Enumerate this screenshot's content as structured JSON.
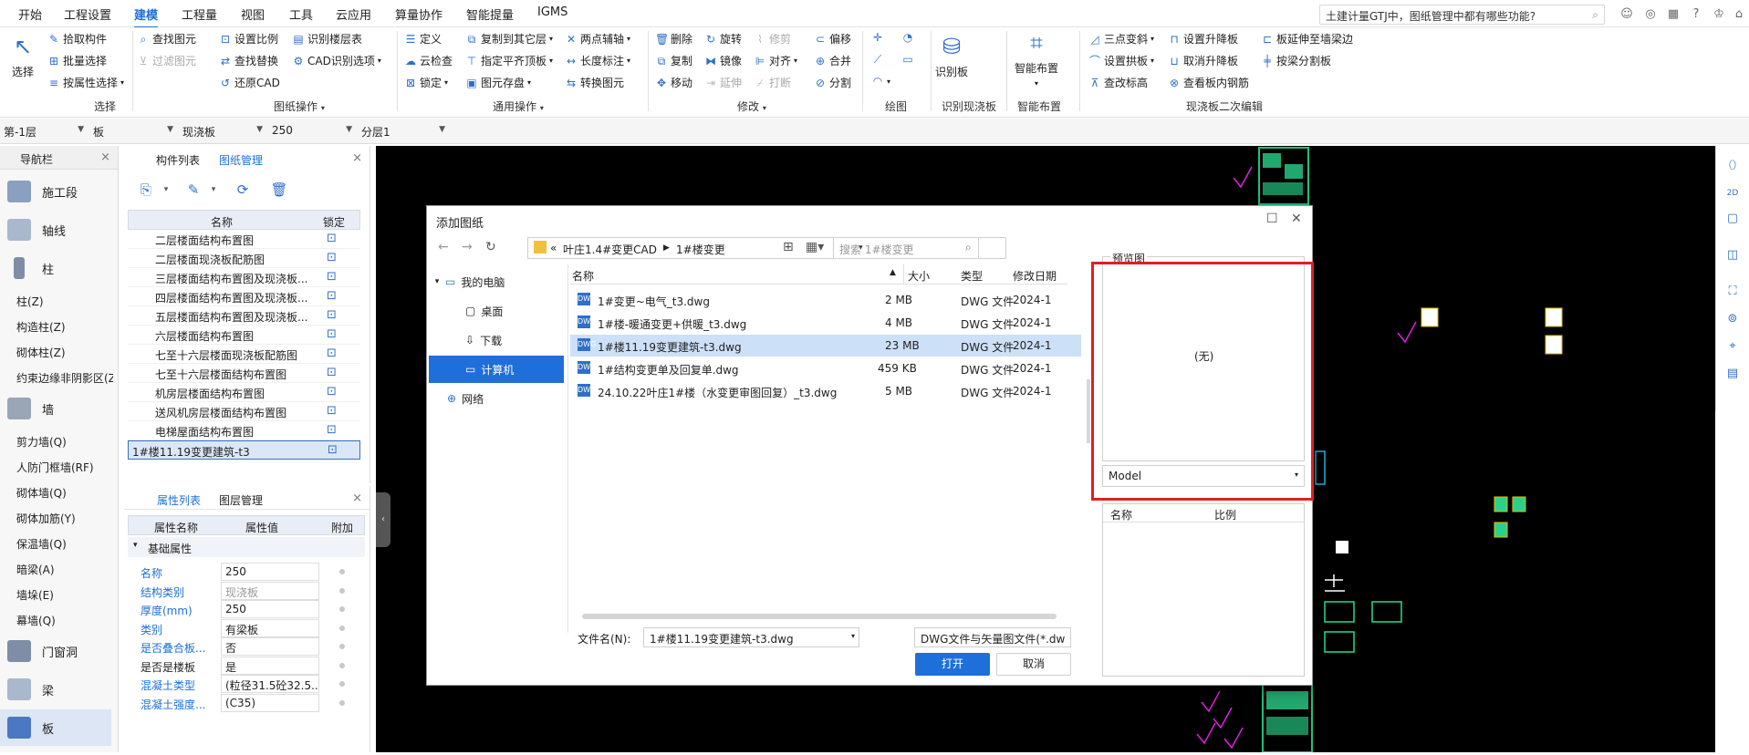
{
  "menu": {
    "tabs": [
      "开始",
      "工程设置",
      "建模",
      "工程量",
      "视图",
      "工具",
      "云应用",
      "算量协作",
      "智能提量",
      "IGMS"
    ],
    "active_tab": "建模",
    "search_text": "土建计量GTJ中，图纸管理中都有哪些功能?"
  },
  "ribbon": {
    "select_big": "选择",
    "select_items": [
      "拾取构件",
      "批量选择",
      "按属性选择"
    ],
    "group_select": "选择",
    "cad_col1": [
      "查找图元",
      "过滤图元"
    ],
    "cad_col2": [
      "设置比例",
      "查找替换",
      "还原CAD"
    ],
    "cad_col3": [
      "识别楼层表",
      "CAD识别选项"
    ],
    "group_cad": "图纸操作",
    "gen_col1": [
      "定义",
      "云检查",
      "锁定"
    ],
    "gen_col2": [
      "复制到其它层",
      "指定平齐顶板",
      "图元存盘"
    ],
    "gen_col3": [
      "两点辅轴",
      "长度标注",
      "转换图元"
    ],
    "group_general": "通用操作",
    "mod_col1": [
      "删除",
      "复制",
      "移动"
    ],
    "mod_col2": [
      "旋转",
      "镜像",
      "延伸"
    ],
    "mod_col3": [
      "修剪",
      "对齐",
      "打断"
    ],
    "mod_col4": [
      "偏移",
      "合并",
      "分割"
    ],
    "group_modify": "修改",
    "group_draw": "绘图",
    "recog_big": "识别板",
    "group_recog": "识别现浇板",
    "smart_big": "智能布置",
    "group_smart": "智能布置",
    "sec_col1": [
      "三点变斜",
      "设置拱板",
      "查改标高"
    ],
    "sec_col2": [
      "设置升降板",
      "取消升降板",
      "查看板内钢筋"
    ],
    "sec_col3": [
      "板延伸至墙梁边",
      "按梁分割板"
    ],
    "group_second": "现浇板二次编辑"
  },
  "propbar": {
    "floor": "第-1层",
    "type": "板",
    "subtype": "现浇板",
    "name": "250",
    "layer": "分层1"
  },
  "nav": {
    "title": "导航栏",
    "cats": {
      "construction": "施工段",
      "axis": "轴线",
      "column": "柱",
      "wall": "墙",
      "opening": "门窗洞",
      "beam": "梁",
      "slab": "板"
    },
    "column_items": [
      "柱(Z)",
      "构造柱(Z)",
      "砌体柱(Z)",
      "约束边缘非阴影区(Z"
    ],
    "wall_items": [
      "剪力墙(Q)",
      "人防门框墙(RF)",
      "砌体墙(Q)",
      "砌体加筋(Y)",
      "保温墙(Q)",
      "暗梁(A)",
      "墙垛(E)",
      "幕墙(Q)"
    ]
  },
  "drawing_panel": {
    "tabs": [
      "构件列表",
      "图纸管理"
    ],
    "active": "图纸管理",
    "col_name": "名称",
    "col_lock": "锁定",
    "rows": [
      "二层楼面结构布置图",
      "二层楼面现浇板配筋图",
      "三层楼面结构布置图及现浇板...",
      "四层楼面结构布置图及现浇板...",
      "五层楼面结构布置图及现浇板...",
      "六层楼面结构布置图",
      "七至十六层楼面现浇板配筋图",
      "七至十六层楼面结构布置图",
      "机房层楼面结构布置图",
      "送风机房层楼面结构布置图",
      "电梯屋面结构布置图"
    ],
    "highlight_row": "1#楼11.19变更建筑-t3"
  },
  "prop_panel": {
    "tabs": [
      "属性列表",
      "图层管理"
    ],
    "active": "属性列表",
    "col_name": "属性名称",
    "col_value": "属性值",
    "col_extra": "附加",
    "section": "基础属性",
    "rows": [
      {
        "n": "名称",
        "v": "250"
      },
      {
        "n": "结构类别",
        "v": "现浇板"
      },
      {
        "n": "厚度(mm)",
        "v": "250"
      },
      {
        "n": "类别",
        "v": "有梁板"
      },
      {
        "n": "是否叠合板...",
        "v": "否"
      },
      {
        "n": "是否是楼板",
        "v": "是"
      },
      {
        "n": "混凝土类型",
        "v": "(粒径31.5砼32.5..."
      },
      {
        "n": "混凝土强度...",
        "v": "(C35)"
      }
    ]
  },
  "dialog": {
    "title": "添加图纸",
    "path": [
      "叶庄1.4#变更CAD",
      "1#楼变更"
    ],
    "search_placeholder": "搜索 1#楼变更",
    "tree": [
      "我的电脑",
      "桌面",
      "下载",
      "计算机",
      "网络"
    ],
    "cols": {
      "name": "名称",
      "size": "大小",
      "type": "类型",
      "date": "修改日期"
    },
    "files": [
      {
        "name": "1#变更~电气_t3.dwg",
        "size": "2 MB",
        "type": "DWG 文件",
        "date": "2024-1"
      },
      {
        "name": "1#楼-暖通变更+供暖_t3.dwg",
        "size": "4 MB",
        "type": "DWG 文件",
        "date": "2024-1"
      },
      {
        "name": "1#楼11.19变更建筑-t3.dwg",
        "size": "23 MB",
        "type": "DWG 文件",
        "date": "2024-1"
      },
      {
        "name": "1#结构变更单及回复单.dwg",
        "size": "459 KB",
        "type": "DWG 文件",
        "date": "2024-1"
      },
      {
        "name": "24.10.22叶庄1#楼（水变更审图回复）_t3.dwg",
        "size": "5 MB",
        "type": "DWG 文件",
        "date": "2024-1"
      }
    ],
    "filename_label": "文件名(N):",
    "filename_value": "1#楼11.19变更建筑-t3.dwg",
    "filter": "DWG文件与矢量图文件(*.dw",
    "open": "打开",
    "cancel": "取消",
    "preview_label": "预览图",
    "preview_none": "(无)",
    "model": "Model",
    "layer_cols": {
      "name": "名称",
      "scale": "比例"
    }
  }
}
